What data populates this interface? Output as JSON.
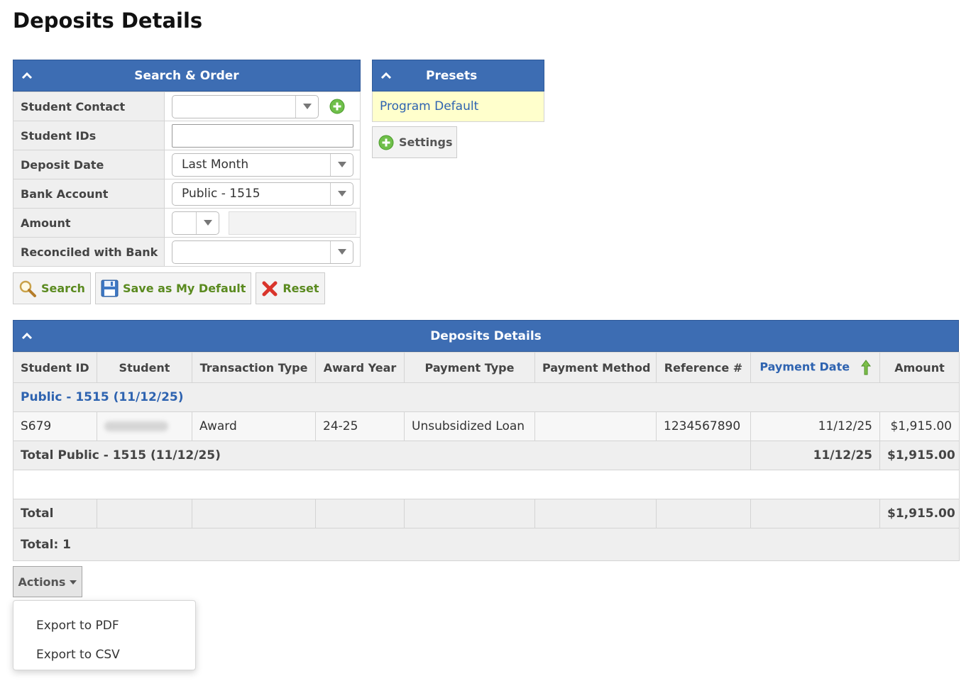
{
  "page": {
    "title": "Deposits Details"
  },
  "search_panel": {
    "title": "Search & Order",
    "fields": [
      {
        "label": "Student Contact",
        "value": ""
      },
      {
        "label": "Student IDs",
        "value": ""
      },
      {
        "label": "Deposit Date",
        "value": "Last Month"
      },
      {
        "label": "Bank Account",
        "value": "Public - 1515"
      },
      {
        "label": "Amount",
        "operator": "",
        "value": ""
      },
      {
        "label": "Reconciled with Bank",
        "value": ""
      }
    ],
    "buttons": {
      "search": "Search",
      "save_default": "Save as My Default",
      "reset": "Reset"
    }
  },
  "presets_panel": {
    "title": "Presets",
    "items": [
      "Program Default"
    ],
    "settings_label": "Settings"
  },
  "results": {
    "title": "Deposits Details",
    "columns": [
      "Student ID",
      "Student",
      "Transaction Type",
      "Award Year",
      "Payment Type",
      "Payment Method",
      "Reference #",
      "Payment Date",
      "Amount"
    ],
    "sorted_column": "Payment Date",
    "group": {
      "label": "Public - 1515 (11/12/25)"
    },
    "rows": [
      {
        "student_id": "S679",
        "student": "",
        "transaction_type": "Award",
        "award_year": "24-25",
        "payment_type": "Unsubsidized Loan",
        "payment_method": "",
        "reference": "1234567890",
        "payment_date": "11/12/25",
        "amount": "$1,915.00"
      }
    ],
    "subtotal": {
      "label": "Total Public - 1515 (11/12/25)",
      "payment_date": "11/12/25",
      "amount": "$1,915.00"
    },
    "total": {
      "label": "Total",
      "amount": "$1,915.00"
    },
    "count": "Total: 1"
  },
  "actions": {
    "label": "Actions",
    "menu": [
      "Export to PDF",
      "Export to CSV"
    ]
  },
  "colors": {
    "header_blue": "#3d6db3",
    "link_blue": "#2e63b0",
    "button_green": "#5a8a1f",
    "preset_bg": "#ffffcc"
  }
}
